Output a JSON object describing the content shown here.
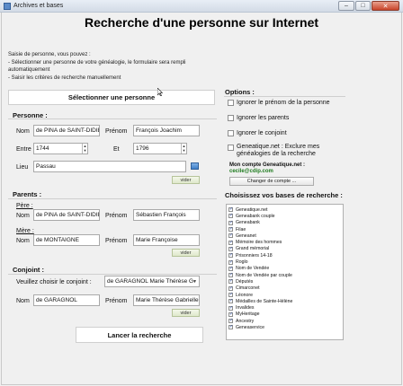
{
  "window": {
    "title": "Archives et bases",
    "buttons": {
      "minimize": "‒",
      "maximize": "□",
      "close": "✕"
    }
  },
  "header": {
    "title": "Recherche d'une personne sur Internet",
    "intro_lines": [
      "Saisie de personne, vous pouvez :",
      "- Sélectionner une personne de votre généalogie,  le formulaire sera rempli automatiquement",
      "- Saisir les critères de recherche manuellement"
    ]
  },
  "select_person_button": "Sélectionner une personne",
  "personne": {
    "label": "Personne :",
    "nom_label": "Nom",
    "nom_value": "de PINA de SAINT-DIDIER",
    "prenom_label": "Prénom",
    "prenom_value": "François Joachim",
    "entre_label": "Entre",
    "entre_value": "1744",
    "et_label": "Et",
    "et_value": "1796",
    "lieu_label": "Lieu",
    "lieu_value": "Passau",
    "vider": "vider"
  },
  "parents": {
    "label": "Parents :",
    "pere_label": "Père :",
    "pere_nom_label": "Nom",
    "pere_nom_value": "de PINA de SAINT-DIDIER",
    "pere_prenom_label": "Prénom",
    "pere_prenom_value": "Sébastien François",
    "mere_label": "Mère :",
    "mere_nom_label": "Nom",
    "mere_nom_value": "de MONTAIGNE",
    "mere_prenom_label": "Prénom",
    "mere_prenom_value": "Marie Françoise",
    "vider": "vider"
  },
  "conjoint": {
    "label": "Conjoint :",
    "choose_label": "Veuillez choisir le conjoint :",
    "choose_value": "de GARAGNOL Marie Thérèse Gabrielle",
    "nom_label": "Nom",
    "nom_value": "de GARAGNOL",
    "prenom_label": "Prénom",
    "prenom_value": "Marie Thérèse Gabrielle",
    "vider": "vider"
  },
  "launch_button": "Lancer la recherche",
  "options": {
    "label": "Options :",
    "items": [
      {
        "label": "Ignorer le prénom de la personne",
        "checked": false
      },
      {
        "label": "Ignorer les parents",
        "checked": false
      },
      {
        "label": "Ignorer le conjoint",
        "checked": false
      },
      {
        "label": "Geneatique.net : Exclure mes généalogies de la recherche",
        "checked": false
      }
    ],
    "compte_label": "Mon compte Geneatique.net :",
    "compte_email": "cecile@cdip.com",
    "change_button": "Changer de compte ..."
  },
  "bases": {
    "label": "Choisissez vos bases de recherche :",
    "items": [
      "Geneatique.net",
      "Geneabank couple",
      "Geneabank",
      "Filae",
      "Geneanet",
      "Mémoire des hommes",
      "Grand mémorial",
      "Prisonniers 14-18",
      "Roglo",
      "Nom de Vendée",
      "Nom de Vendée par couple",
      "Députés",
      "Cimarconet",
      "Léonore",
      "Médailles de Sainte-Hélène",
      "Invalides",
      "MyHeritage",
      "Ancestry",
      "Geneaservice"
    ]
  },
  "colors": {
    "email": "#1c7a1c",
    "check": "#1c3f9a",
    "vider_bg": "#dfe8cb"
  }
}
